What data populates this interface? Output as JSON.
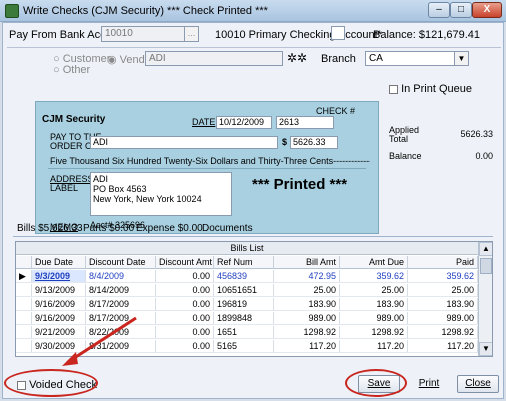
{
  "window": {
    "title": "Write Checks  (CJM Security) *** Check Printed  ***",
    "controls": {
      "minimize": "–",
      "maximize": "□",
      "close": "X"
    }
  },
  "header": {
    "pay_from_label": "Pay From Bank Account",
    "account_value": "10010",
    "account_name": "10010 Primary Checking Account*",
    "balance": "Balance: $121,679.41"
  },
  "payee_type": {
    "customer": "Customer",
    "vendor": "Vendor",
    "other": "Other",
    "selected": "Vendor",
    "payee_value": "ADI",
    "branch_label": "Branch",
    "branch_value": "CA"
  },
  "check": {
    "company": "CJM Security",
    "check_label": "CHECK #",
    "check_number": "2613",
    "date_label": "DATE",
    "date": "10/12/2009",
    "pay_to_label_1": "PAY TO THE",
    "pay_to_label_2": "ORDER OF",
    "pay_to": "ADI",
    "amount_symbol": "$",
    "amount": "5626.33",
    "amount_words": "Five Thousand Six Hundred Twenty-Six Dollars and Thirty-Three Cents-------------------------------",
    "address_label_1": "ADDRESS",
    "address_label_2": "LABEL",
    "address_lines": [
      "ADI",
      "PO Box 4563",
      "New York, New York  10024"
    ],
    "printed_stamp": "*** Printed ***",
    "memo_label": "MEMO",
    "memo": "Acct# 325696"
  },
  "side": {
    "in_print_queue": "In Print Queue",
    "applied_label_1": "Applied",
    "applied_label_2": "Total",
    "applied_total": "5626.33",
    "balance_label": "Balance",
    "balance_value": "0.00"
  },
  "tabs": [
    {
      "label": "Bills  $5,626.33"
    },
    {
      "label": "Parts  $0.00"
    },
    {
      "label": "Expense  $0.00"
    },
    {
      "label": "Documents"
    }
  ],
  "bills": {
    "caption": "Bills List",
    "columns": [
      "Due Date",
      "Discount Date",
      "Discount Amt",
      "Ref Num",
      "Bill Amt",
      "Amt Due",
      "Paid"
    ],
    "rows": [
      [
        "9/3/2009",
        "8/4/2009",
        "0.00",
        "456839",
        "472.95",
        "359.62",
        "359.62"
      ],
      [
        "9/13/2009",
        "8/14/2009",
        "0.00",
        "10651651",
        "25.00",
        "25.00",
        "25.00"
      ],
      [
        "9/16/2009",
        "8/17/2009",
        "0.00",
        "196819",
        "183.90",
        "183.90",
        "183.90"
      ],
      [
        "9/16/2009",
        "8/17/2009",
        "0.00",
        "1899848",
        "989.00",
        "989.00",
        "989.00"
      ],
      [
        "9/21/2009",
        "8/22/2009",
        "0.00",
        "1651",
        "1298.92",
        "1298.92",
        "1298.92"
      ],
      [
        "9/30/2009",
        "8/31/2009",
        "0.00",
        "5165",
        "117.20",
        "117.20",
        "117.20"
      ]
    ]
  },
  "footer": {
    "voided_check": "Voided Check",
    "save": "Save",
    "print": "Print",
    "close": "Close"
  },
  "colors": {
    "check_bg": "#a9d0e0",
    "highlight_red": "#c8261f",
    "link_blue": "#1f3fbf"
  }
}
